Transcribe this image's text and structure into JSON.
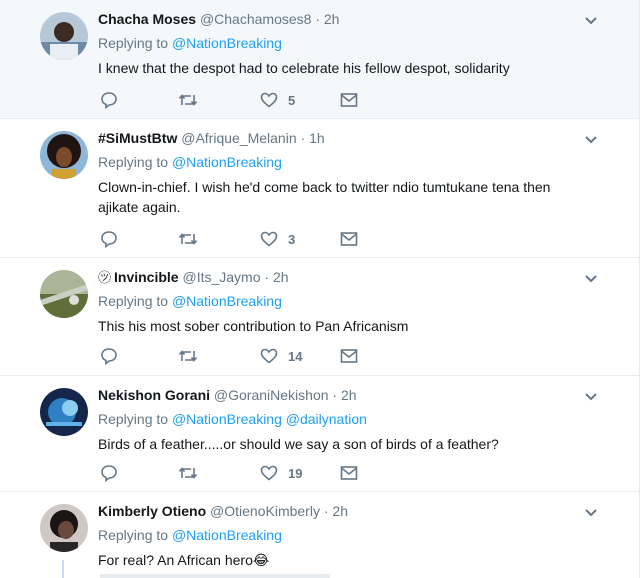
{
  "tweets": [
    {
      "fullname": "Chacha Moses",
      "badge": "",
      "screen_name": "@Chachamoses8",
      "time": "2h",
      "replying_label": "Replying to",
      "mentions": [
        "@NationBreaking"
      ],
      "text": "I knew that the despot had to celebrate his fellow despot, solidarity",
      "likes": "5",
      "highlighted": true,
      "avatar_color": "#8fa9c4"
    },
    {
      "fullname": "#SiMustBtw",
      "badge": "",
      "screen_name": "@Afrique_Melanin",
      "time": "1h",
      "replying_label": "Replying to",
      "mentions": [
        "@NationBreaking"
      ],
      "text": "Clown-in-chief. I wish he'd come back to twitter ndio tumtukane tena then ajikate again.",
      "likes": "3",
      "highlighted": false,
      "avatar_color": "#5a3a24"
    },
    {
      "fullname": "Invincible",
      "badge": "㋡",
      "screen_name": "@Its_Jaymo",
      "time": "2h",
      "replying_label": "Replying to",
      "mentions": [
        "@NationBreaking"
      ],
      "text": "This his most sober contribution to Pan Africanism",
      "likes": "14",
      "highlighted": false,
      "avatar_color": "#7d8a58"
    },
    {
      "fullname": "Nekishon Gorani",
      "badge": "",
      "screen_name": "@GoraniNekishon",
      "time": "2h",
      "replying_label": "Replying to",
      "mentions": [
        "@NationBreaking",
        "@dailynation"
      ],
      "text": "Birds of a feather.....or should we say a son of birds of a feather?",
      "likes": "19",
      "highlighted": false,
      "avatar_color": "#2b6fa8"
    },
    {
      "fullname": "Kimberly Otieno",
      "badge": "",
      "screen_name": "@OtienoKimberly",
      "time": "2h",
      "replying_label": "Replying to",
      "mentions": [
        "@NationBreaking"
      ],
      "text": "For real? An African hero😂",
      "likes": "",
      "highlighted": false,
      "avatar_color": "#3b3436"
    }
  ],
  "icons": {
    "reply": "reply-icon",
    "retweet": "retweet-icon",
    "like": "heart-icon",
    "dm": "envelope-icon",
    "more": "chevron-down-icon"
  },
  "colors": {
    "link": "#1da1f2",
    "secondary": "#657786",
    "border": "#e6ecf0",
    "highlight_bg": "#f5f8fa"
  }
}
